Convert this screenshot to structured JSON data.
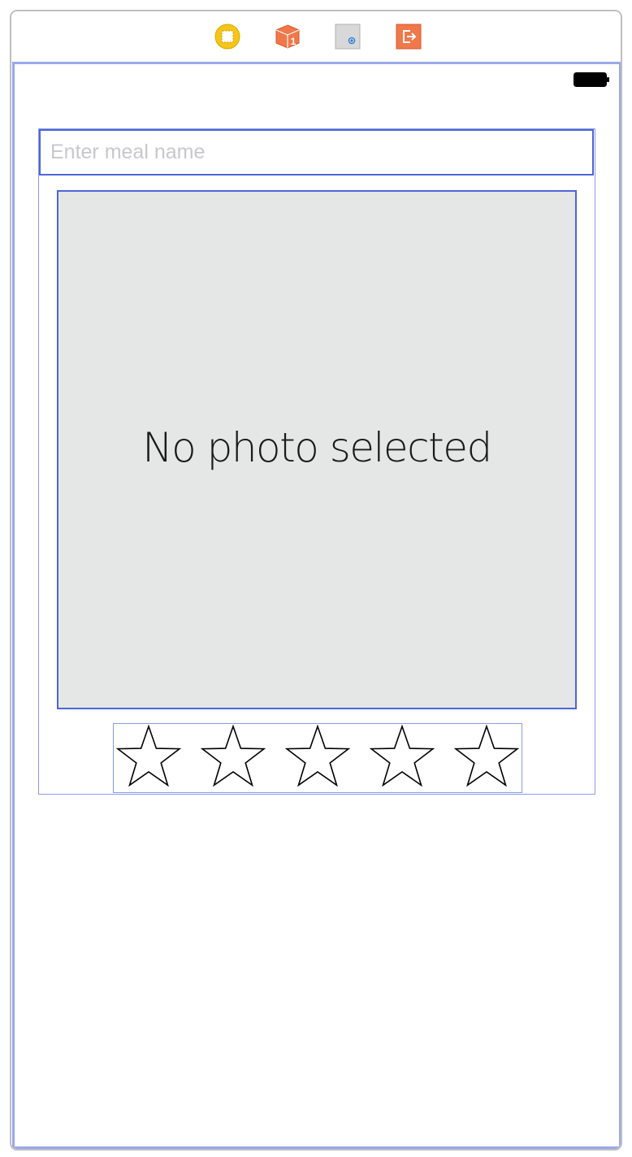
{
  "scene_dock": {
    "items": [
      {
        "name": "view-controller-icon",
        "color": "#f5c518"
      },
      {
        "name": "first-responder-icon",
        "color": "#f0784a",
        "badge": "1"
      },
      {
        "name": "tap-gesture-icon",
        "color": "#d8d8d8"
      },
      {
        "name": "exit-icon",
        "color": "#f0784a"
      }
    ]
  },
  "status_bar": {
    "battery_icon": "battery-full-icon"
  },
  "meal_form": {
    "name_field": {
      "placeholder": "Enter meal name",
      "value": ""
    },
    "photo": {
      "placeholder_text": "No photo selected",
      "background": "#e5e6e6"
    },
    "rating": {
      "max": 5,
      "value": 0,
      "star_icon": "empty-star-icon"
    }
  },
  "colors": {
    "selection_border": "#4d66d6",
    "view_outline": "#9aa8ec"
  }
}
